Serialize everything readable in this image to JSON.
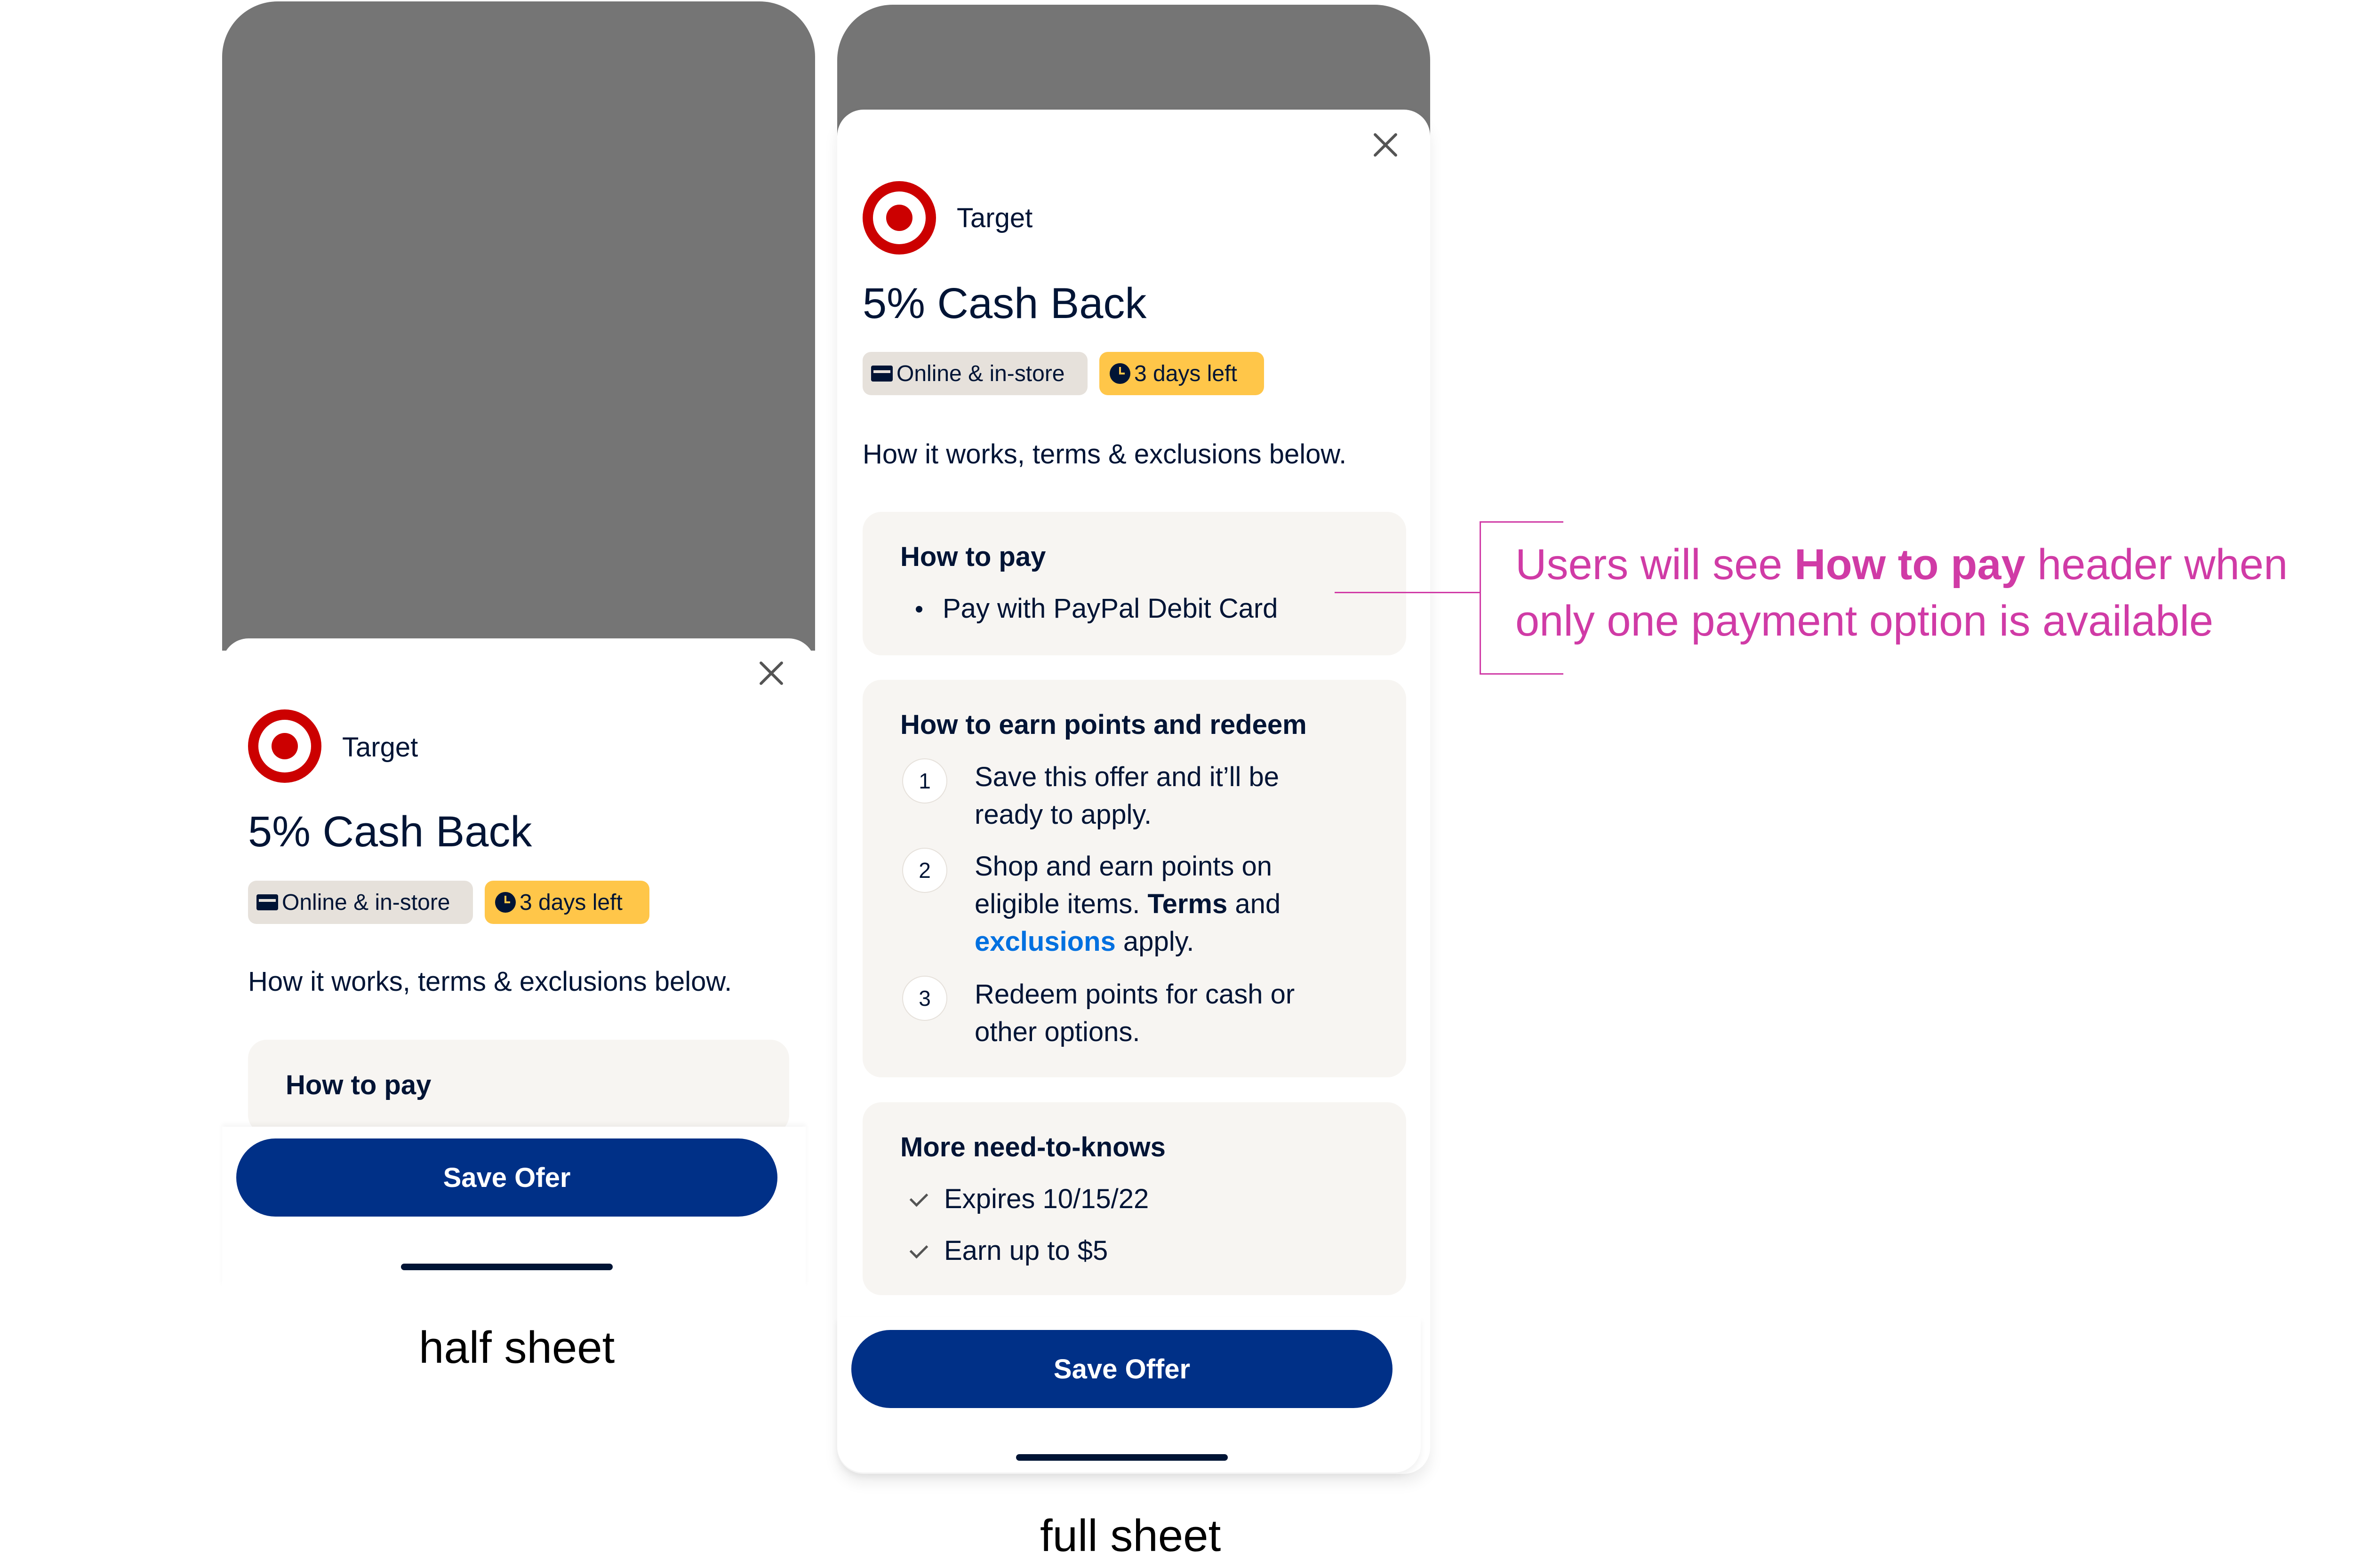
{
  "half_sheet": {
    "merchant": "Target",
    "offer_title": "5% Cash Back",
    "chip_channel": "Online & in-store",
    "chip_time": "3 days left",
    "intro": "How it works, terms & exclusions below.",
    "how_to_pay_header": "How to pay",
    "save_button": "Save Ofer",
    "caption": "half sheet"
  },
  "full_sheet": {
    "merchant": "Target",
    "offer_title": "5% Cash Back",
    "chip_channel": "Online & in-store",
    "chip_time": "3 days left",
    "intro": "How it works, terms & exclusions below.",
    "how_to_pay": {
      "header": "How to pay",
      "items": [
        "Pay with PayPal Debit Card"
      ]
    },
    "earn": {
      "header": "How to earn points and redeem",
      "steps": [
        {
          "num": "1",
          "line1": "Save this offer and it’ll be",
          "line2": "ready to apply."
        },
        {
          "num": "2",
          "line1": "Shop and earn points on",
          "line2_a": "eligible items. ",
          "line2_b": "Terms",
          "line2_c": " and",
          "line3_link": "exclusions",
          "line3_rest": " apply."
        },
        {
          "num": "3",
          "line1": "Redeem points for cash or",
          "line2": "other options."
        }
      ]
    },
    "need_to_knows": {
      "header": "More need-to-knows",
      "items": [
        "Expires 10/15/22",
        "Earn up to $5"
      ]
    },
    "save_button": "Save Offer",
    "caption": "full sheet"
  },
  "annotation": {
    "line1_pre": "Users will see ",
    "line1_bold": "How to pay",
    "line1_post": " header when",
    "line2": "only one payment option is available",
    "color": "#d03ba6"
  },
  "colors": {
    "primary_button": "#003087",
    "brand_red": "#cc0000",
    "chip_yellow": "#ffc649",
    "link_blue": "#0070e0"
  }
}
